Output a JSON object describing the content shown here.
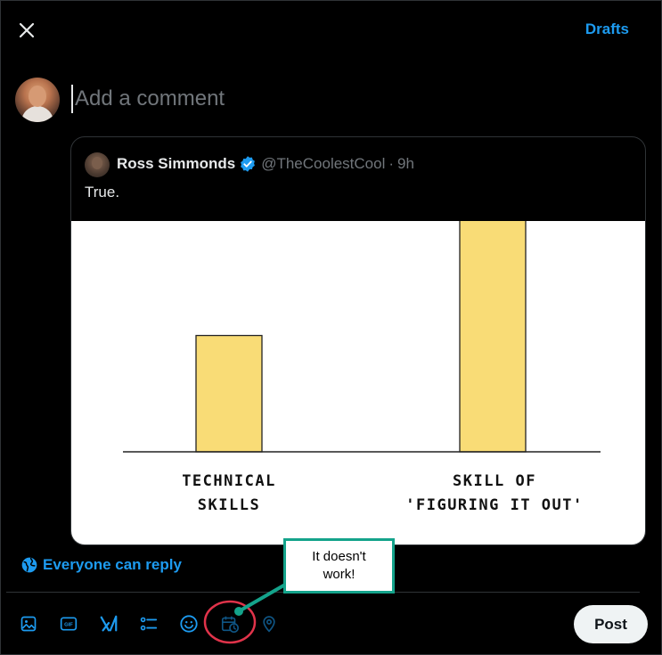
{
  "header": {
    "close_icon": "close-icon",
    "drafts_label": "Drafts"
  },
  "composer": {
    "placeholder": "Add a comment"
  },
  "quote": {
    "author_name": "Ross Simmonds",
    "verified_icon": "verified-badge-icon",
    "handle": "@TheCoolestCool",
    "separator": "·",
    "time": "9h",
    "text": "True."
  },
  "chart_data": {
    "type": "bar",
    "categories": [
      "TECHNICAL SKILLS",
      "SKILL OF 'FIGURING IT OUT'"
    ],
    "category_lines": [
      [
        "TECHNICAL",
        "SKILLS"
      ],
      [
        "SKILL OF",
        "'FIGURING IT OUT'"
      ]
    ],
    "values": [
      0.5,
      1.0
    ],
    "title": "",
    "xlabel": "",
    "ylabel": "",
    "ylim": [
      0,
      1
    ],
    "grid": false,
    "bar_color": "#f9dc76",
    "bar_stroke": "#222222"
  },
  "reply_setting": {
    "label": "Everyone can reply",
    "icon": "globe-icon"
  },
  "toolbar": {
    "items": [
      {
        "name": "media-icon"
      },
      {
        "name": "gif-icon",
        "text": "GIF"
      },
      {
        "name": "grok-icon"
      },
      {
        "name": "poll-icon"
      },
      {
        "name": "emoji-icon"
      },
      {
        "name": "schedule-icon"
      },
      {
        "name": "location-icon"
      }
    ],
    "post_label": "Post"
  },
  "annotation": {
    "callout_text": "It doesn't work!",
    "circle_color": "#e0334a",
    "callout_color": "#14a38b"
  },
  "colors": {
    "accent": "#1d9bf0",
    "background": "#000000",
    "border": "#2f3336",
    "muted_text": "#71767b",
    "primary_text": "#e7e9ea"
  }
}
